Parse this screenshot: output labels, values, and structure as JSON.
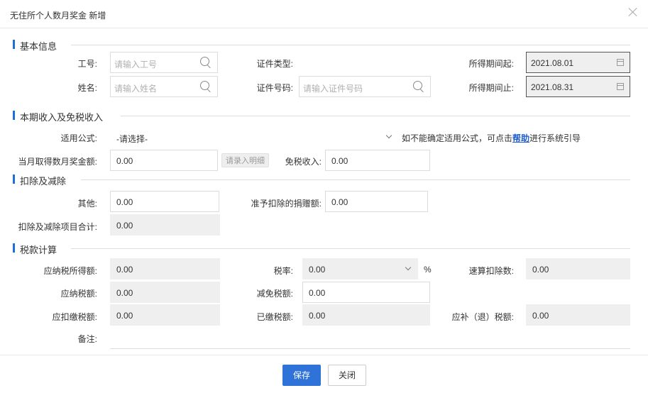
{
  "dialog": {
    "title": "无住所个人数月奖金 新增"
  },
  "sections": {
    "basic": "基本信息",
    "income": "本期收入及免税收入",
    "deduction": "扣除及减除",
    "tax": "税款计算"
  },
  "basic": {
    "employee_no_label": "工号:",
    "employee_no_placeholder": "请输入工号",
    "name_label": "姓名:",
    "name_placeholder": "请输入姓名",
    "id_type_label": "证件类型:",
    "id_no_label": "证件号码:",
    "id_no_placeholder": "请输入证件号码",
    "period_start_label": "所得期间起:",
    "period_start_value": "2021.08.01",
    "period_end_label": "所得期间止:",
    "period_end_value": "2021.08.31"
  },
  "income": {
    "formula_label": "适用公式:",
    "formula_value": "-请选择-",
    "hint_prefix": "如不能确定适用公式，可点击",
    "hint_link": "帮助",
    "hint_suffix": "进行系统引导",
    "bonus_label": "当月取得数月奖金额:",
    "bonus_value": "0.00",
    "detail_button": "请录入明细",
    "taxfree_label": "免税收入:",
    "taxfree_value": "0.00"
  },
  "deduction": {
    "other_label": "其他:",
    "other_value": "0.00",
    "donation_label": "准予扣除的捐赠额:",
    "donation_value": "0.00",
    "total_label": "扣除及减除项目合计:",
    "total_value": "0.00"
  },
  "tax": {
    "taxable_income_label": "应纳税所得额:",
    "taxable_income_value": "0.00",
    "rate_label": "税率:",
    "rate_value": "0.00",
    "rate_unit": "%",
    "quick_deduction_label": "速算扣除数:",
    "quick_deduction_value": "0.00",
    "tax_payable_label": "应纳税额:",
    "tax_payable_value": "0.00",
    "tax_reduction_label": "减免税额:",
    "tax_reduction_value": "0.00",
    "withhold_label": "应扣缴税额:",
    "withhold_value": "0.00",
    "paid_label": "已缴税额:",
    "paid_value": "0.00",
    "refund_label": "应补（退）税额:",
    "refund_value": "0.00",
    "remark_label": "备注:"
  },
  "footer": {
    "save": "保存",
    "close": "关闭"
  },
  "colors": {
    "accent": "#2f73d8",
    "section_bar": "#1f6fd6",
    "link": "#1f5fd0"
  }
}
